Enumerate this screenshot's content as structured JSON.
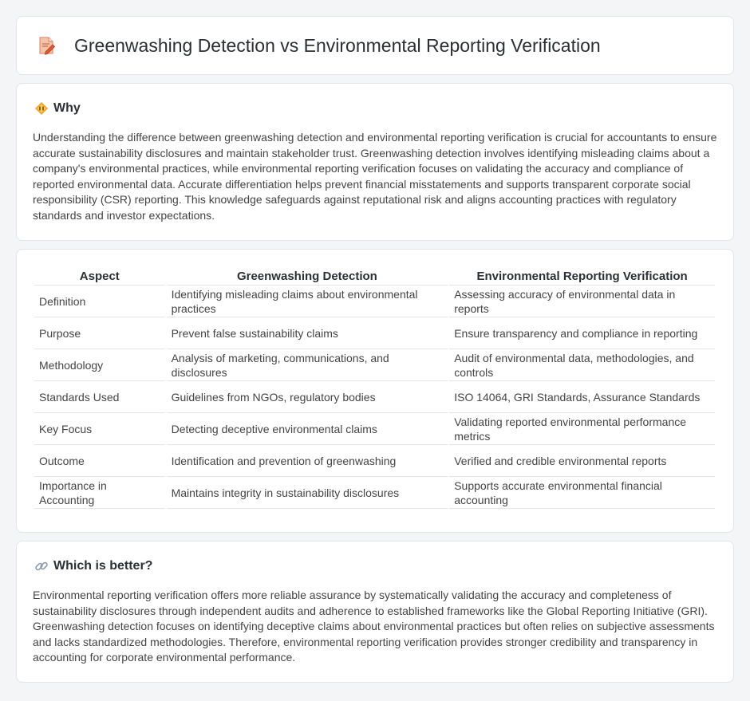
{
  "header": {
    "title": "Greenwashing Detection vs Environmental Reporting Verification",
    "icon": "document-pencil-icon"
  },
  "why": {
    "title": "Why",
    "icon": "diamond-warning-icon",
    "text": "Understanding the difference between greenwashing detection and environmental reporting verification is crucial for accountants to ensure accurate sustainability disclosures and maintain stakeholder trust. Greenwashing detection involves identifying misleading claims about a company's environmental practices, while environmental reporting verification focuses on validating the accuracy and compliance of reported environmental data. Accurate differentiation helps prevent financial misstatements and supports transparent corporate social responsibility (CSR) reporting. This knowledge safeguards against reputational risk and aligns accounting practices with regulatory standards and investor expectations."
  },
  "table": {
    "headers": [
      "Aspect",
      "Greenwashing Detection",
      "Environmental Reporting Verification"
    ],
    "rows": [
      [
        "Definition",
        "Identifying misleading claims about environmental practices",
        "Assessing accuracy of environmental data in reports"
      ],
      [
        "Purpose",
        "Prevent false sustainability claims",
        "Ensure transparency and compliance in reporting"
      ],
      [
        "Methodology",
        "Analysis of marketing, communications, and disclosures",
        "Audit of environmental data, methodologies, and controls"
      ],
      [
        "Standards Used",
        "Guidelines from NGOs, regulatory bodies",
        "ISO 14064, GRI Standards, Assurance Standards"
      ],
      [
        "Key Focus",
        "Detecting deceptive environmental claims",
        "Validating reported environmental performance metrics"
      ],
      [
        "Outcome",
        "Identification and prevention of greenwashing",
        "Verified and credible environmental reports"
      ],
      [
        "Importance in Accounting",
        "Maintains integrity in sustainability disclosures",
        "Supports accurate environmental financial accounting"
      ]
    ]
  },
  "better": {
    "title": "Which is better?",
    "icon": "link-icon",
    "text": "Environmental reporting verification offers more reliable assurance by systematically validating the accuracy and completeness of sustainability disclosures through independent audits and adherence to established frameworks like the Global Reporting Initiative (GRI). Greenwashing detection focuses on identifying deceptive claims about environmental practices but often relies on subjective assessments and lacks standardized methodologies. Therefore, environmental reporting verification provides stronger credibility and transparency in accounting for corporate environmental performance."
  }
}
